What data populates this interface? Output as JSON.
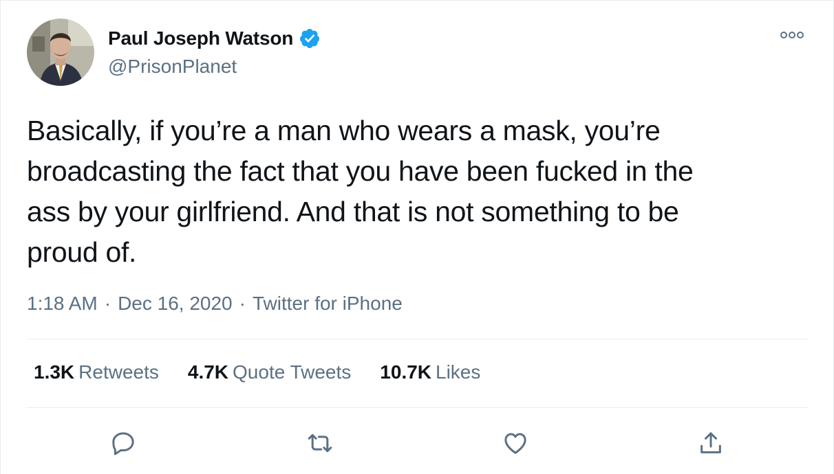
{
  "author": {
    "display_name": "Paul Joseph Watson",
    "handle": "@PrisonPlanet",
    "verified": true,
    "avatar_icon": "profile-photo"
  },
  "tweet": {
    "text": "Basically, if you’re a man who wears a mask, you’re\nbroadcasting the fact that you have been fucked in the\nass by your girlfriend. And that is not something to be\nproud of.",
    "time": "1:18 AM",
    "date": "Dec 16, 2020",
    "source": "Twitter for iPhone",
    "separator": "·"
  },
  "stats": {
    "retweets_count": "1.3K",
    "retweets_label": "Retweets",
    "quotes_count": "4.7K",
    "quotes_label": "Quote Tweets",
    "likes_count": "10.7K",
    "likes_label": "Likes"
  },
  "actions": [
    "reply-icon",
    "retweet-icon",
    "like-icon",
    "share-icon"
  ],
  "colors": {
    "text_primary": "#0f1419",
    "text_secondary": "#5b7083",
    "verified_blue": "#1da1f2",
    "divider": "#e6ecf0"
  }
}
